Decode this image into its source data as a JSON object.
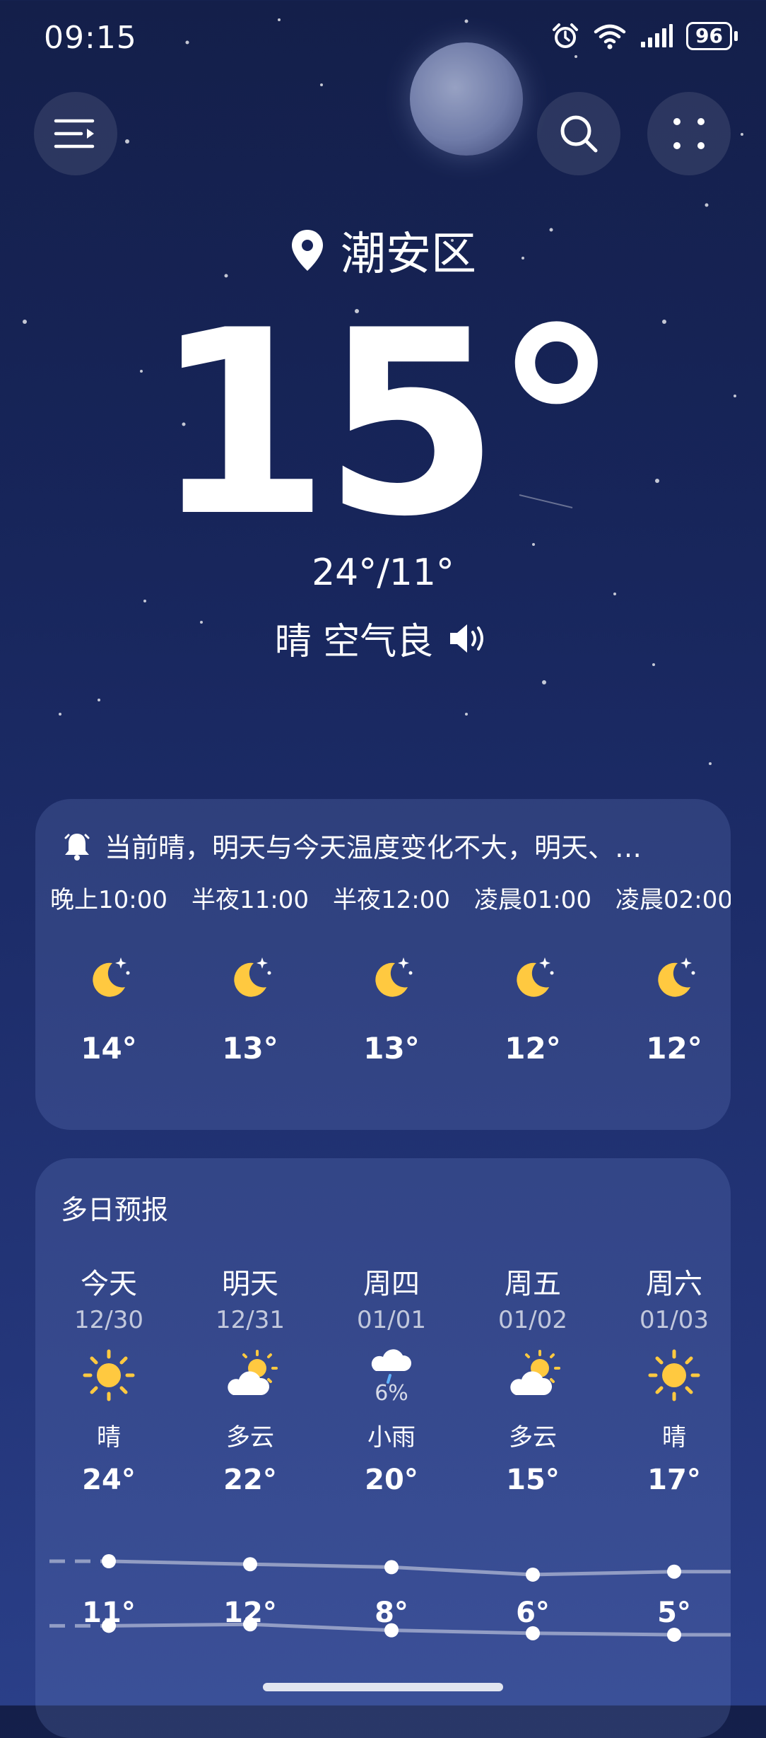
{
  "status_bar": {
    "time": "09:15",
    "battery": "96"
  },
  "header": {
    "location": "潮安区"
  },
  "current": {
    "temperature": "15°",
    "high_low": "24°/11°",
    "condition": "晴 空气良"
  },
  "alert": {
    "text": "当前晴，明天与今天温度变化不大，明天、…"
  },
  "hourly": [
    {
      "time": "晚上10:00",
      "temp": "14°",
      "icon": "moon-stars-icon"
    },
    {
      "time": "半夜11:00",
      "temp": "13°",
      "icon": "moon-stars-icon"
    },
    {
      "time": "半夜12:00",
      "temp": "13°",
      "icon": "moon-stars-icon"
    },
    {
      "time": "凌晨01:00",
      "temp": "12°",
      "icon": "moon-stars-icon"
    },
    {
      "time": "凌晨02:00",
      "temp": "12°",
      "icon": "moon-stars-icon"
    }
  ],
  "forecast": {
    "title": "多日预报",
    "days": [
      {
        "name": "今天",
        "date": "12/30",
        "icon": "sun-icon",
        "precip": "",
        "weather": "晴",
        "high": "24°",
        "low": "11°"
      },
      {
        "name": "明天",
        "date": "12/31",
        "icon": "partly-cloudy-icon",
        "precip": "",
        "weather": "多云",
        "high": "22°",
        "low": "12°"
      },
      {
        "name": "周四",
        "date": "01/01",
        "icon": "light-rain-icon",
        "precip": "6%",
        "weather": "小雨",
        "high": "20°",
        "low": "8°"
      },
      {
        "name": "周五",
        "date": "01/02",
        "icon": "partly-cloudy-icon",
        "precip": "",
        "weather": "多云",
        "high": "15°",
        "low": "6°"
      },
      {
        "name": "周六",
        "date": "01/03",
        "icon": "sun-icon",
        "precip": "",
        "weather": "晴",
        "high": "17°",
        "low": "5°"
      }
    ]
  },
  "colors": {
    "sun": "#ffc940",
    "moon": "#ffc940",
    "card_bg": "rgba(120,140,210,0.22)"
  }
}
